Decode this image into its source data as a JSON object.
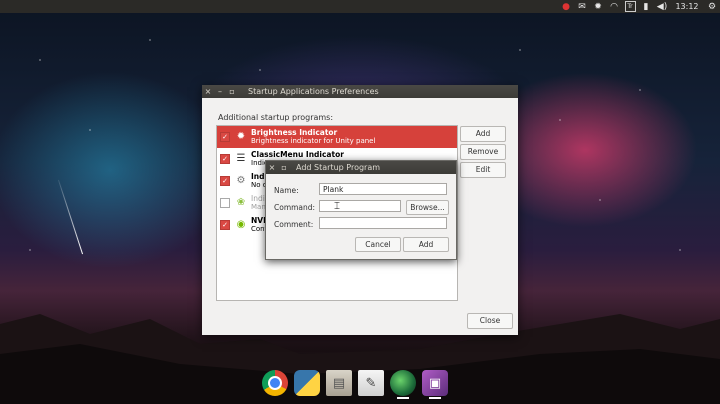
{
  "panel": {
    "clock": "13:12",
    "keyboard_indicator": "Tr",
    "icons": [
      "record-icon",
      "mail-icon",
      "brightness-icon",
      "wifi-icon",
      "keyboard-icon",
      "battery-icon",
      "volume-icon"
    ]
  },
  "main_window": {
    "title": "Startup Applications Preferences",
    "section_label": "Additional startup programs:",
    "programs": [
      {
        "name": "Brightness Indicator",
        "desc": "Brightness indicator for Unity panel",
        "checked": true,
        "icon": "sun-icon"
      },
      {
        "name": "ClassicMenu Indicator",
        "desc": "Indica",
        "checked": true,
        "icon": "menu-icon"
      },
      {
        "name": "Indic",
        "desc": "No de",
        "checked": true,
        "icon": "gear-icon"
      },
      {
        "name": "Indic",
        "desc": "Mana",
        "checked": false,
        "icon": "leaf-icon"
      },
      {
        "name": "NVID",
        "desc": "Conf",
        "checked": true,
        "icon": "nvidia-icon"
      }
    ],
    "buttons": {
      "add": "Add",
      "remove": "Remove",
      "edit": "Edit",
      "close": "Close"
    }
  },
  "dialog": {
    "title": "Add Startup Program",
    "name_label": "Name:",
    "name_value": "Plank",
    "command_label": "Command:",
    "command_value": "",
    "comment_label": "Comment:",
    "comment_value": "",
    "browse": "Browse...",
    "cancel": "Cancel",
    "add": "Add"
  },
  "dock": [
    "chrome-icon",
    "python-icon",
    "archive-icon",
    "text-editor-icon",
    "globe-icon",
    "photos-icon"
  ]
}
